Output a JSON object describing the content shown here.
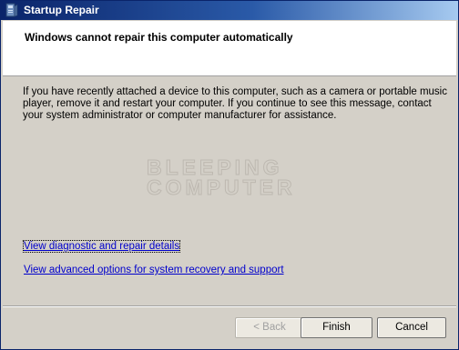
{
  "window": {
    "title": "Startup Repair",
    "icon": "startup-repair-app-icon"
  },
  "header": {
    "heading": "Windows cannot repair this computer automatically"
  },
  "main": {
    "message": "If you have recently attached a device to this computer, such as a camera or portable music player, remove it and restart your computer. If you continue to see this message, contact your system administrator or computer manufacturer for assistance.",
    "watermark_line1": "BLEEPING",
    "watermark_line2": "COMPUTER",
    "links": {
      "diagnostic": "View diagnostic and repair details",
      "advanced": "View advanced options for system recovery and support"
    }
  },
  "buttons": {
    "back": "< Back",
    "finish": "Finish",
    "cancel": "Cancel"
  },
  "colors": {
    "titlebar": "#0a246a",
    "face": "#d4d0c8",
    "link": "#0000cc"
  }
}
